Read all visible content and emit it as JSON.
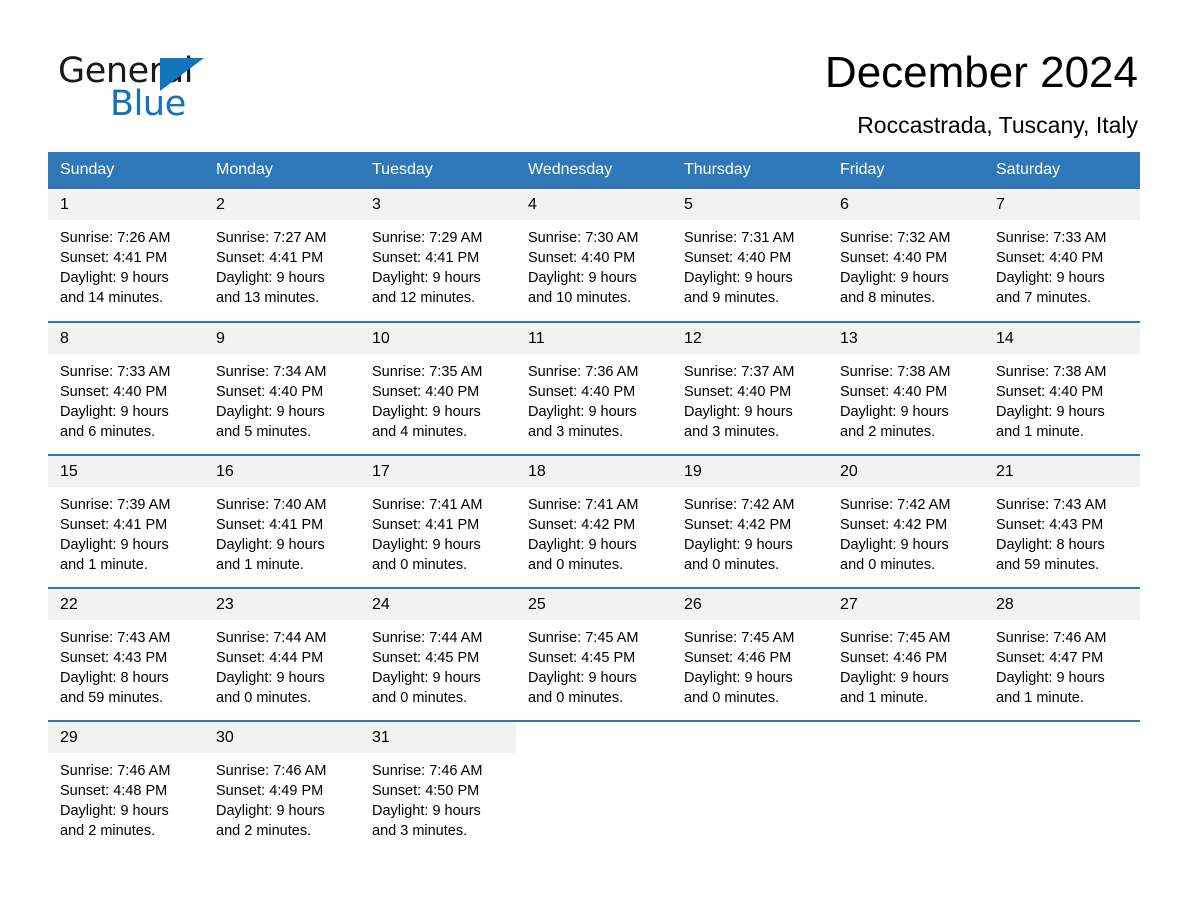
{
  "brand": {
    "name_part1": "General",
    "name_part2": "Blue",
    "triangle_color": "#1275bc"
  },
  "header": {
    "title": "December 2024",
    "subtitle": "Roccastrada, Tuscany, Italy",
    "accent_color": "#2e78b8",
    "daynum_band_color": "#f2f2f2"
  },
  "weekdays": [
    "Sunday",
    "Monday",
    "Tuesday",
    "Wednesday",
    "Thursday",
    "Friday",
    "Saturday"
  ],
  "weeks": [
    [
      {
        "day": "1",
        "sunrise": "Sunrise: 7:26 AM",
        "sunset": "Sunset: 4:41 PM",
        "daylight1": "Daylight: 9 hours",
        "daylight2": "and 14 minutes."
      },
      {
        "day": "2",
        "sunrise": "Sunrise: 7:27 AM",
        "sunset": "Sunset: 4:41 PM",
        "daylight1": "Daylight: 9 hours",
        "daylight2": "and 13 minutes."
      },
      {
        "day": "3",
        "sunrise": "Sunrise: 7:29 AM",
        "sunset": "Sunset: 4:41 PM",
        "daylight1": "Daylight: 9 hours",
        "daylight2": "and 12 minutes."
      },
      {
        "day": "4",
        "sunrise": "Sunrise: 7:30 AM",
        "sunset": "Sunset: 4:40 PM",
        "daylight1": "Daylight: 9 hours",
        "daylight2": "and 10 minutes."
      },
      {
        "day": "5",
        "sunrise": "Sunrise: 7:31 AM",
        "sunset": "Sunset: 4:40 PM",
        "daylight1": "Daylight: 9 hours",
        "daylight2": "and 9 minutes."
      },
      {
        "day": "6",
        "sunrise": "Sunrise: 7:32 AM",
        "sunset": "Sunset: 4:40 PM",
        "daylight1": "Daylight: 9 hours",
        "daylight2": "and 8 minutes."
      },
      {
        "day": "7",
        "sunrise": "Sunrise: 7:33 AM",
        "sunset": "Sunset: 4:40 PM",
        "daylight1": "Daylight: 9 hours",
        "daylight2": "and 7 minutes."
      }
    ],
    [
      {
        "day": "8",
        "sunrise": "Sunrise: 7:33 AM",
        "sunset": "Sunset: 4:40 PM",
        "daylight1": "Daylight: 9 hours",
        "daylight2": "and 6 minutes."
      },
      {
        "day": "9",
        "sunrise": "Sunrise: 7:34 AM",
        "sunset": "Sunset: 4:40 PM",
        "daylight1": "Daylight: 9 hours",
        "daylight2": "and 5 minutes."
      },
      {
        "day": "10",
        "sunrise": "Sunrise: 7:35 AM",
        "sunset": "Sunset: 4:40 PM",
        "daylight1": "Daylight: 9 hours",
        "daylight2": "and 4 minutes."
      },
      {
        "day": "11",
        "sunrise": "Sunrise: 7:36 AM",
        "sunset": "Sunset: 4:40 PM",
        "daylight1": "Daylight: 9 hours",
        "daylight2": "and 3 minutes."
      },
      {
        "day": "12",
        "sunrise": "Sunrise: 7:37 AM",
        "sunset": "Sunset: 4:40 PM",
        "daylight1": "Daylight: 9 hours",
        "daylight2": "and 3 minutes."
      },
      {
        "day": "13",
        "sunrise": "Sunrise: 7:38 AM",
        "sunset": "Sunset: 4:40 PM",
        "daylight1": "Daylight: 9 hours",
        "daylight2": "and 2 minutes."
      },
      {
        "day": "14",
        "sunrise": "Sunrise: 7:38 AM",
        "sunset": "Sunset: 4:40 PM",
        "daylight1": "Daylight: 9 hours",
        "daylight2": "and 1 minute."
      }
    ],
    [
      {
        "day": "15",
        "sunrise": "Sunrise: 7:39 AM",
        "sunset": "Sunset: 4:41 PM",
        "daylight1": "Daylight: 9 hours",
        "daylight2": "and 1 minute."
      },
      {
        "day": "16",
        "sunrise": "Sunrise: 7:40 AM",
        "sunset": "Sunset: 4:41 PM",
        "daylight1": "Daylight: 9 hours",
        "daylight2": "and 1 minute."
      },
      {
        "day": "17",
        "sunrise": "Sunrise: 7:41 AM",
        "sunset": "Sunset: 4:41 PM",
        "daylight1": "Daylight: 9 hours",
        "daylight2": "and 0 minutes."
      },
      {
        "day": "18",
        "sunrise": "Sunrise: 7:41 AM",
        "sunset": "Sunset: 4:42 PM",
        "daylight1": "Daylight: 9 hours",
        "daylight2": "and 0 minutes."
      },
      {
        "day": "19",
        "sunrise": "Sunrise: 7:42 AM",
        "sunset": "Sunset: 4:42 PM",
        "daylight1": "Daylight: 9 hours",
        "daylight2": "and 0 minutes."
      },
      {
        "day": "20",
        "sunrise": "Sunrise: 7:42 AM",
        "sunset": "Sunset: 4:42 PM",
        "daylight1": "Daylight: 9 hours",
        "daylight2": "and 0 minutes."
      },
      {
        "day": "21",
        "sunrise": "Sunrise: 7:43 AM",
        "sunset": "Sunset: 4:43 PM",
        "daylight1": "Daylight: 8 hours",
        "daylight2": "and 59 minutes."
      }
    ],
    [
      {
        "day": "22",
        "sunrise": "Sunrise: 7:43 AM",
        "sunset": "Sunset: 4:43 PM",
        "daylight1": "Daylight: 8 hours",
        "daylight2": "and 59 minutes."
      },
      {
        "day": "23",
        "sunrise": "Sunrise: 7:44 AM",
        "sunset": "Sunset: 4:44 PM",
        "daylight1": "Daylight: 9 hours",
        "daylight2": "and 0 minutes."
      },
      {
        "day": "24",
        "sunrise": "Sunrise: 7:44 AM",
        "sunset": "Sunset: 4:45 PM",
        "daylight1": "Daylight: 9 hours",
        "daylight2": "and 0 minutes."
      },
      {
        "day": "25",
        "sunrise": "Sunrise: 7:45 AM",
        "sunset": "Sunset: 4:45 PM",
        "daylight1": "Daylight: 9 hours",
        "daylight2": "and 0 minutes."
      },
      {
        "day": "26",
        "sunrise": "Sunrise: 7:45 AM",
        "sunset": "Sunset: 4:46 PM",
        "daylight1": "Daylight: 9 hours",
        "daylight2": "and 0 minutes."
      },
      {
        "day": "27",
        "sunrise": "Sunrise: 7:45 AM",
        "sunset": "Sunset: 4:46 PM",
        "daylight1": "Daylight: 9 hours",
        "daylight2": "and 1 minute."
      },
      {
        "day": "28",
        "sunrise": "Sunrise: 7:46 AM",
        "sunset": "Sunset: 4:47 PM",
        "daylight1": "Daylight: 9 hours",
        "daylight2": "and 1 minute."
      }
    ],
    [
      {
        "day": "29",
        "sunrise": "Sunrise: 7:46 AM",
        "sunset": "Sunset: 4:48 PM",
        "daylight1": "Daylight: 9 hours",
        "daylight2": "and 2 minutes."
      },
      {
        "day": "30",
        "sunrise": "Sunrise: 7:46 AM",
        "sunset": "Sunset: 4:49 PM",
        "daylight1": "Daylight: 9 hours",
        "daylight2": "and 2 minutes."
      },
      {
        "day": "31",
        "sunrise": "Sunrise: 7:46 AM",
        "sunset": "Sunset: 4:50 PM",
        "daylight1": "Daylight: 9 hours",
        "daylight2": "and 3 minutes."
      },
      {
        "day": "",
        "sunrise": "",
        "sunset": "",
        "daylight1": "",
        "daylight2": ""
      },
      {
        "day": "",
        "sunrise": "",
        "sunset": "",
        "daylight1": "",
        "daylight2": ""
      },
      {
        "day": "",
        "sunrise": "",
        "sunset": "",
        "daylight1": "",
        "daylight2": ""
      },
      {
        "day": "",
        "sunrise": "",
        "sunset": "",
        "daylight1": "",
        "daylight2": ""
      }
    ]
  ]
}
